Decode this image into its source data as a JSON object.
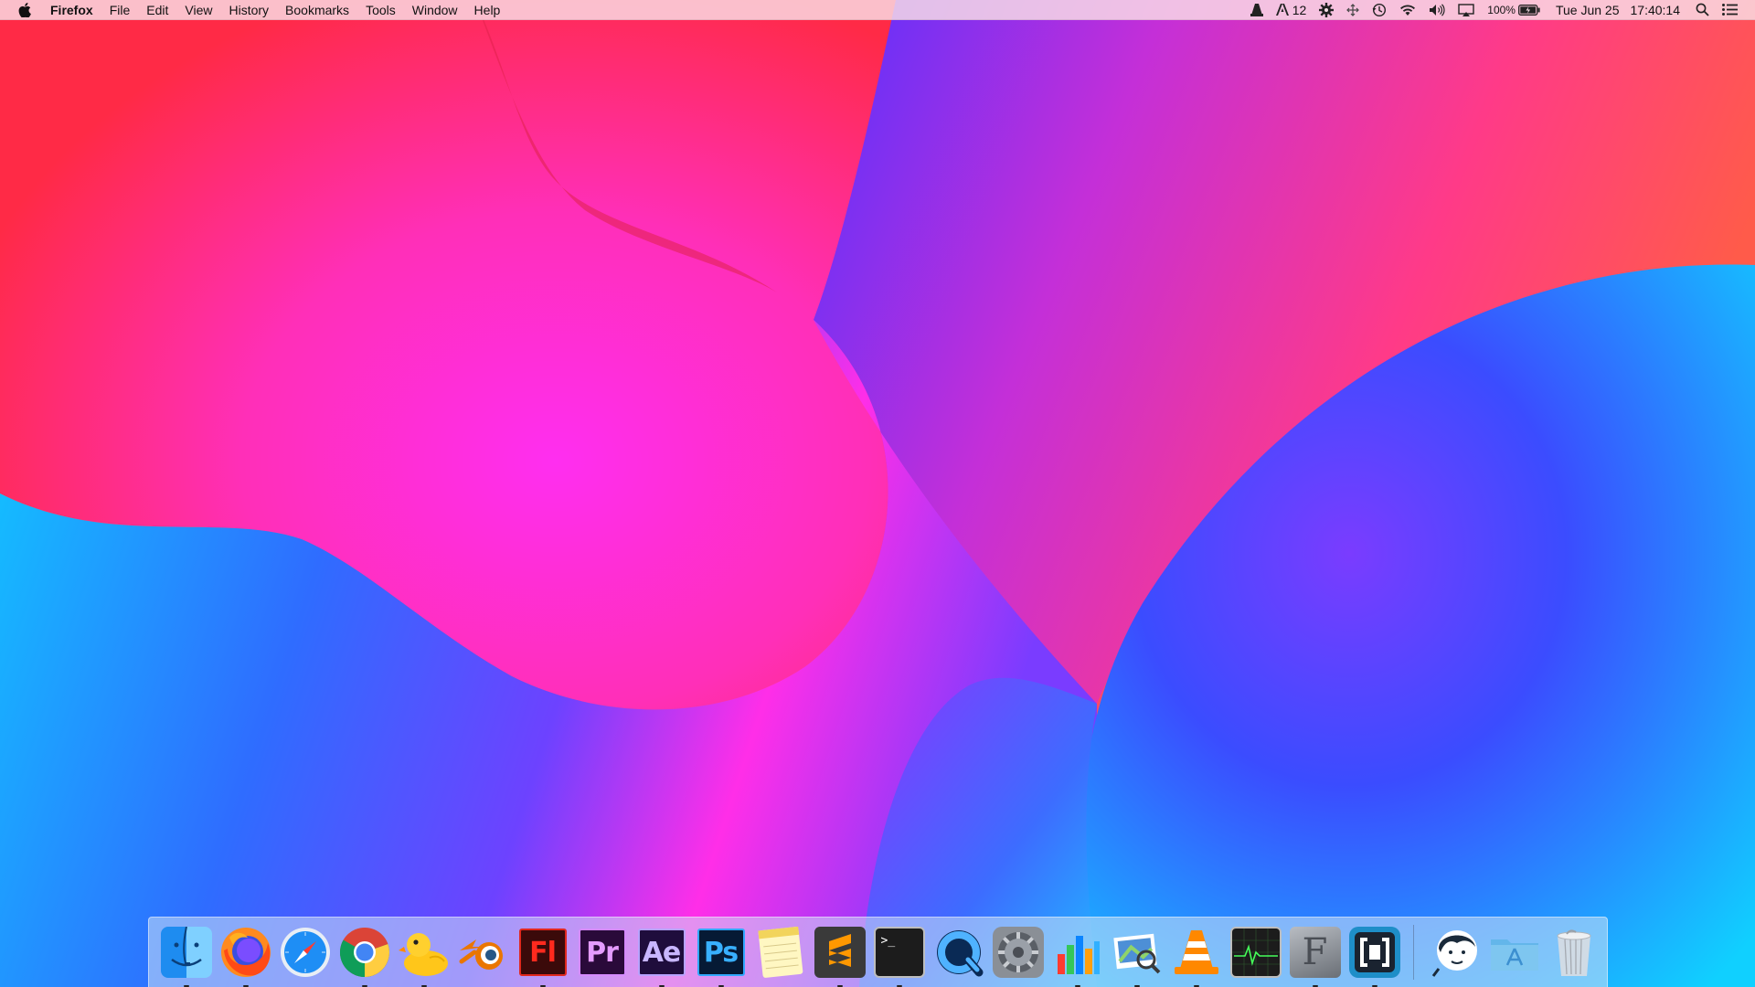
{
  "menubar": {
    "app_name": "Firefox",
    "menus": [
      "File",
      "Edit",
      "View",
      "History",
      "Bookmarks",
      "Tools",
      "Window",
      "Help"
    ],
    "status": {
      "adobe_count": "12",
      "battery_percent": "100%",
      "date": "Tue Jun 25",
      "time": "17:40:14"
    }
  },
  "dock": {
    "apps": [
      {
        "name": "finder-icon",
        "running": true
      },
      {
        "name": "firefox-icon",
        "running": true
      },
      {
        "name": "safari-icon",
        "running": false
      },
      {
        "name": "chrome-icon",
        "running": true
      },
      {
        "name": "cyberduck-icon",
        "running": true
      },
      {
        "name": "blender-icon",
        "running": false
      },
      {
        "name": "flash-icon",
        "label": "Fl",
        "running": true
      },
      {
        "name": "premiere-icon",
        "label": "Pr",
        "running": false
      },
      {
        "name": "after-effects-icon",
        "label": "Ae",
        "running": true
      },
      {
        "name": "photoshop-icon",
        "label": "Ps",
        "running": true
      },
      {
        "name": "notes-icon",
        "running": false
      },
      {
        "name": "sublime-text-icon",
        "running": true
      },
      {
        "name": "terminal-icon",
        "label": ">_",
        "running": true
      },
      {
        "name": "quicktime-icon",
        "running": false
      },
      {
        "name": "system-preferences-icon",
        "running": false
      },
      {
        "name": "numbers-icon",
        "running": true
      },
      {
        "name": "preview-icon",
        "running": true
      },
      {
        "name": "vlc-icon",
        "running": true
      },
      {
        "name": "activity-monitor-icon",
        "running": false
      },
      {
        "name": "fontlab-icon",
        "label": "F",
        "running": true
      },
      {
        "name": "brackets-icon",
        "running": true
      }
    ],
    "right_items": [
      {
        "name": "user-avatar-icon"
      },
      {
        "name": "applications-folder-icon"
      },
      {
        "name": "trash-icon"
      }
    ]
  },
  "colors": {
    "orange": "#ff7a2a",
    "magenta": "#ff2ee8",
    "pink": "#ff3e8a",
    "blue": "#2a3bff",
    "cyan": "#11c4ff",
    "violet": "#8a35ff"
  }
}
